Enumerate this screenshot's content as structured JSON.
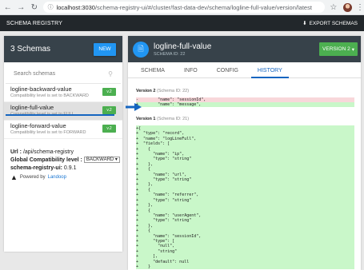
{
  "browser": {
    "url_host": "localhost:3030",
    "url_path": "/schema-registry-ui/#/cluster/fast-data-dev/schema/logline-full-value/version/latest"
  },
  "header": {
    "title": "SCHEMA REGISTRY",
    "export_label": "EXPORT SCHEMAS"
  },
  "sidebar": {
    "count_label": "3 Schemas",
    "new_label": "NEW",
    "search_placeholder": "Search schemas",
    "items": [
      {
        "name": "logline-backward-value",
        "sub": "Compatibility level is set to BACKWARD",
        "badge": "v.2"
      },
      {
        "name": "logline-full-value",
        "sub": "Compatibility level is set to FULL",
        "badge": "v.2"
      },
      {
        "name": "logline-forward-value",
        "sub": "Compatibility level is set to FORWARD",
        "badge": "v.2"
      }
    ],
    "url_label": "Url :",
    "url_value": "/api/schema-registry",
    "compat_label": "Global Compatibility level :",
    "compat_value": "BACKWARD",
    "version_label": "schema-registry-ui:",
    "version_value": "0.9.1",
    "powered_label": "Powered by",
    "powered_link": "Landoop"
  },
  "schema": {
    "name": "logline-full-value",
    "id_label": "SCHEMA ID: 22",
    "version_button": "VERSION 2"
  },
  "tabs": [
    "SCHEMA",
    "INFO",
    "CONFIG",
    "HISTORY"
  ],
  "history": {
    "v2_label": "Version 2",
    "v2_sid": "(Schema ID: 22)",
    "v2_minus": "-        \"name\": \"sessionId\",",
    "v2_plus": "+        \"name\": \"message\",",
    "v1_label": "Version 1",
    "v1_sid": "(Schema ID: 21)",
    "v1_code": "+{\n+  \"type\": \"record\",\n+  \"name\": \"logLineFull\",\n+  \"fields\": [\n+    {\n+      \"name\": \"ip\",\n+      \"type\": \"string\"\n+    },\n+    {\n+      \"name\": \"url\",\n+      \"type\": \"string\"\n+    },\n+    {\n+      \"name\": \"referrer\",\n+      \"type\": \"string\"\n+    },\n+    {\n+      \"name\": \"userAgent\",\n+      \"type\": \"string\"\n+    },\n+    {\n+      \"name\": \"sessionId\",\n+      \"type\": [\n+        \"null\",\n+        \"string\"\n+      ],\n+      \"default\": null\n+    }\n+  ]\n+}"
  },
  "colors": {
    "header_bg": "#22272b",
    "panel_head_bg": "#37424a",
    "accent_blue": "#2196f3",
    "badge_green": "#4caf50",
    "diff_add": "#c9f7c9",
    "diff_remove": "#f8d7da"
  }
}
